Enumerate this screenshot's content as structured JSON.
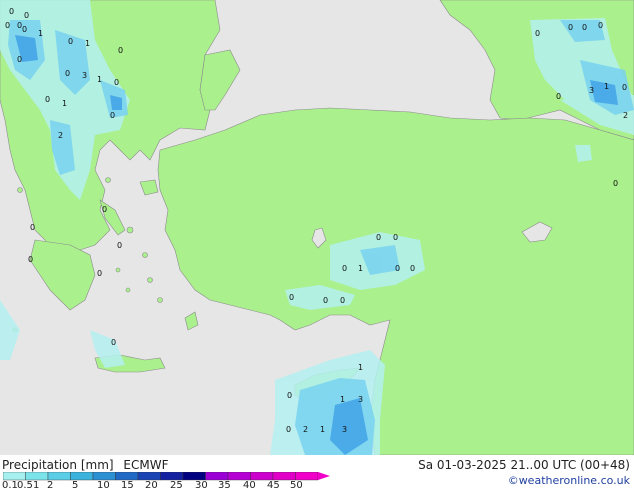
{
  "title": "Precipitation [mm]",
  "model": "ECMWF",
  "valid_time": "Sa 01-03-2025 21..00 UTC (00+48)",
  "credit": "©weatheronline.co.uk",
  "legend": {
    "ticks": [
      "0.1",
      "0.5",
      "1",
      "2",
      "5",
      "10",
      "15",
      "20",
      "25",
      "30",
      "35",
      "40",
      "45",
      "50"
    ],
    "colors": [
      "#a6f0f0",
      "#7de3eb",
      "#5ccde6",
      "#3bb3dc",
      "#2c90d3",
      "#2169c4",
      "#1a44b3",
      "#1421a0",
      "#000080",
      "#9b00d6",
      "#b400d2",
      "#cc00cc",
      "#e000c8",
      "#f000c8"
    ]
  },
  "colors": {
    "land": "#aaf08c",
    "sea": "#e6e6e6",
    "rain_light": "#b4f0f0",
    "rain_mid": "#78d2f0",
    "rain_heavy": "#3ca0e6"
  },
  "point_values": [
    "0",
    "0",
    "1",
    "0",
    "1",
    "0",
    "0",
    "3",
    "1",
    "0",
    "0",
    "0",
    "1",
    "0",
    "2",
    "0",
    "0",
    "0",
    "0",
    "0",
    "0",
    "0",
    "0",
    "0",
    "0",
    "0",
    "0",
    "3",
    "1",
    "0",
    "2",
    "0",
    "0",
    "0",
    "0",
    "0",
    "0",
    "1",
    "0",
    "0",
    "0",
    "0",
    "0",
    "1",
    "0",
    "1",
    "3",
    "0",
    "2",
    "1",
    "3",
    "1"
  ]
}
